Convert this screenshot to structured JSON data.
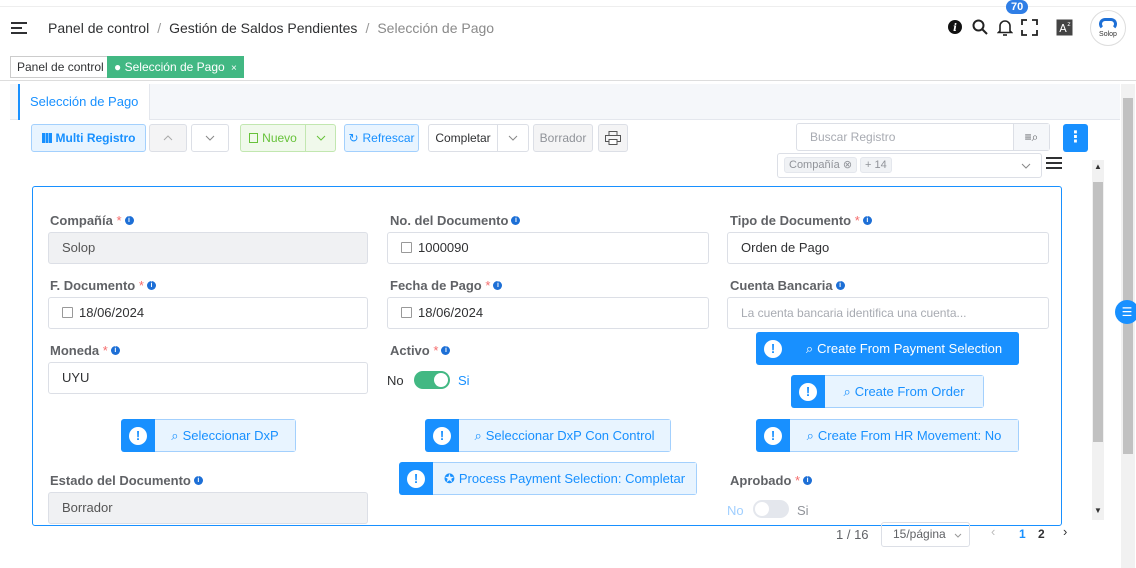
{
  "breadcrumb": [
    "Panel de control",
    "Gestión de Saldos Pendientes",
    "Selección de Pago"
  ],
  "notifications_count": "70",
  "avatar_text": "Solop",
  "tags": [
    {
      "label": "Panel de control",
      "active": false
    },
    {
      "label": "Selección de Pago",
      "close": "×",
      "active": true
    }
  ],
  "tab": {
    "label": "Selección de Pago"
  },
  "toolbar": {
    "multi_registro": "Multi Registro",
    "nuevo": "Nuevo",
    "refrescar": "Refrescar",
    "completar": "Completar",
    "borrador": "Borrador"
  },
  "search": {
    "placeholder": "Buscar Registro"
  },
  "company_filter": {
    "chip": "Compañía",
    "more": "+ 14"
  },
  "form": {
    "compania": {
      "label": "Compañía",
      "value": "Solop"
    },
    "no_documento": {
      "label": "No. del Documento",
      "value": "1000090"
    },
    "tipo_documento": {
      "label": "Tipo de Documento",
      "value": "Orden de Pago"
    },
    "f_documento": {
      "label": "F. Documento",
      "value": "18/06/2024"
    },
    "fecha_pago": {
      "label": "Fecha de Pago",
      "value": "18/06/2024"
    },
    "cuenta_bancaria": {
      "label": "Cuenta Bancaria",
      "placeholder": "La cuenta bancaria identifica una cuenta..."
    },
    "moneda": {
      "label": "Moneda",
      "value": "UYU"
    },
    "activo": {
      "label": "Activo",
      "no": "No",
      "si": "Si",
      "on": true
    },
    "estado_documento": {
      "label": "Estado del Documento",
      "value": "Borrador"
    },
    "aprobado": {
      "label": "Aprobado",
      "no": "No",
      "si": "Si",
      "on": false
    }
  },
  "process_buttons": {
    "create_payment_selection": "Create From Payment Selection",
    "create_order": "Create From Order",
    "create_hr": "Create From HR Movement: No",
    "seleccionar_dxp": "Seleccionar DxP",
    "seleccionar_dxp_control": "Seleccionar DxP Con Control",
    "process_payment": "Process Payment Selection: Completar"
  },
  "pagination": {
    "record": "1 / 16",
    "per_page": "15/página",
    "pages": [
      "1",
      "2"
    ],
    "current": "1"
  },
  "colors": {
    "primary": "#1890ff",
    "success": "#42b883",
    "required": "#f56c6c"
  }
}
